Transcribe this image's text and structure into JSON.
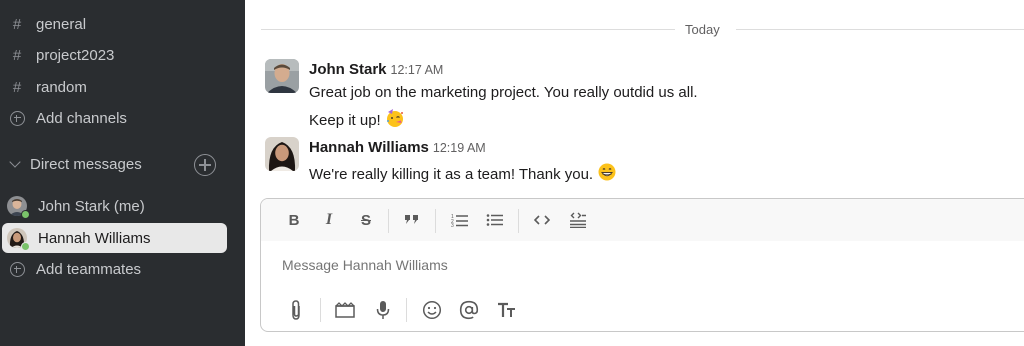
{
  "sidebar": {
    "channels": [
      {
        "prefix": "#",
        "label": "general"
      },
      {
        "prefix": "#",
        "label": "project2023"
      },
      {
        "prefix": "#",
        "label": "random"
      }
    ],
    "add_channels_label": "Add channels",
    "direct_messages_label": "Direct messages",
    "dms": [
      {
        "label": "John Stark (me)",
        "active": false
      },
      {
        "label": "Hannah Williams",
        "active": true
      }
    ],
    "add_teammates_label": "Add teammates"
  },
  "conversation": {
    "day_divider": "Today",
    "messages": [
      {
        "author": "John Stark",
        "time": "12:17 AM",
        "lines": [
          "Great job on the marketing project. You really outdid us all.",
          "Keep it up!"
        ],
        "emoji": "partying-face-emoji"
      },
      {
        "author": "Hannah Williams",
        "time": "12:19 AM",
        "lines": [
          "We're really killing it as a team! Thank you."
        ],
        "emoji": "grinning-face-emoji"
      }
    ]
  },
  "composer": {
    "placeholder": "Message Hannah Williams",
    "format_tools": [
      "bold",
      "italic",
      "strikethrough",
      "quote",
      "ordered-list",
      "bulleted-list",
      "code",
      "code-block"
    ],
    "action_tools": [
      "attach",
      "video-clip",
      "audio-clip",
      "emoji",
      "mention",
      "text-format"
    ]
  },
  "colors": {
    "sidebar_bg": "#2a2d30",
    "active_item_bg": "#e8e8e8",
    "presence_online": "#7ac36a"
  }
}
